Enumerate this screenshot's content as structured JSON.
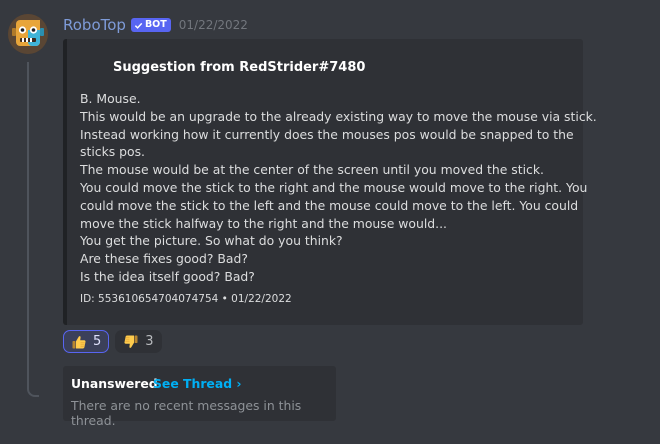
{
  "message": {
    "username": "RoboTop",
    "bot_badge": "BOT",
    "timestamp": "01/22/2022",
    "avatar_icon": "robot-face-icon"
  },
  "embed": {
    "title": "Suggestion from RedStrider#7480",
    "description_lines": [
      "B. Mouse.",
      "This would be an upgrade to the already existing way to move the mouse via stick.",
      "Instead working how it currently does the mouses pos would be snapped to the",
      "sticks pos.",
      "The mouse would be at the center of the screen until you moved the stick.",
      "You could move the stick to the right and the mouse would move to the right. You",
      "could move the stick to the left and the mouse could move to the left. You could",
      "move the stick halfway to the right and the mouse would...",
      "You get the picture. So what do you think?",
      "Are these fixes good? Bad?",
      "Is the idea itself good? Bad?"
    ],
    "footer": "ID: 553610654704074754 • 01/22/2022"
  },
  "reactions": [
    {
      "emoji": "thumbs-up-icon",
      "count": "5",
      "active": true
    },
    {
      "emoji": "thumbs-down-icon",
      "count": "3",
      "active": false
    }
  ],
  "thread": {
    "name": "Unanswered",
    "see_thread_label": "See Thread ›",
    "empty_text": "There are no recent messages in this thread."
  },
  "colors": {
    "background": "#36393f",
    "embed_bg": "#2f3136",
    "username": "#7e9bd8",
    "bot_badge": "#5865f2",
    "link": "#00aff4"
  }
}
